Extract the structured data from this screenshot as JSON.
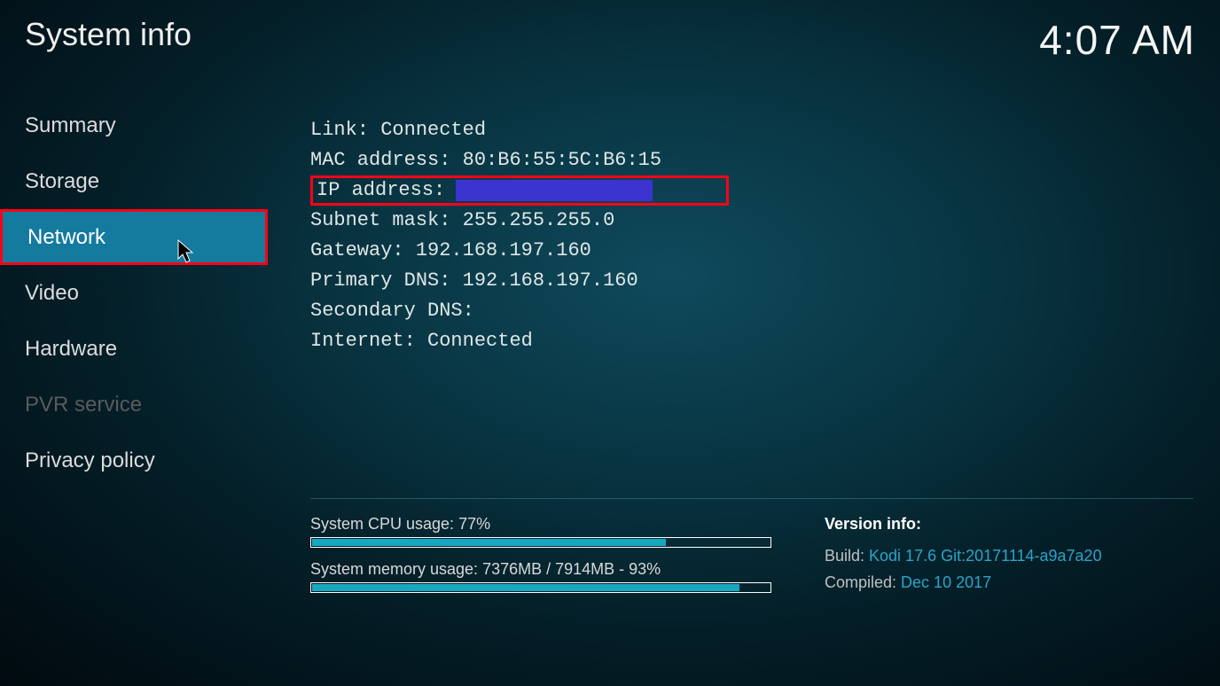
{
  "header": {
    "title": "System info",
    "clock": "4:07 AM"
  },
  "sidebar": {
    "items": [
      {
        "label": "Summary",
        "state": ""
      },
      {
        "label": "Storage",
        "state": ""
      },
      {
        "label": "Network",
        "state": "selected"
      },
      {
        "label": "Video",
        "state": ""
      },
      {
        "label": "Hardware",
        "state": ""
      },
      {
        "label": "PVR service",
        "state": "disabled"
      },
      {
        "label": "Privacy policy",
        "state": ""
      }
    ]
  },
  "network": {
    "link_label": "Link: ",
    "link_value": "Connected",
    "mac_label": "MAC address: ",
    "mac_value": "80:B6:55:5C:B6:15",
    "ip_label": "IP address:",
    "ip_value": "",
    "subnet_label": "Subnet mask: ",
    "subnet_value": "255.255.255.0",
    "gateway_label": "Gateway: ",
    "gateway_value": "192.168.197.160",
    "dns1_label": "Primary DNS: ",
    "dns1_value": "192.168.197.160",
    "dns2_label": "Secondary DNS:",
    "dns2_value": "",
    "internet_label": "Internet: ",
    "internet_value": "Connected"
  },
  "footer": {
    "cpu_label": "System CPU usage: 77%",
    "cpu_pct": 77,
    "mem_label": "System memory usage: 7376MB / 7914MB - 93%",
    "mem_pct": 93,
    "version_title": "Version info:",
    "build_label": "Build:  ",
    "build_value": "Kodi 17.6 Git:20171114-a9a7a20",
    "compiled_label": "Compiled:  ",
    "compiled_value": "Dec 10 2017"
  }
}
